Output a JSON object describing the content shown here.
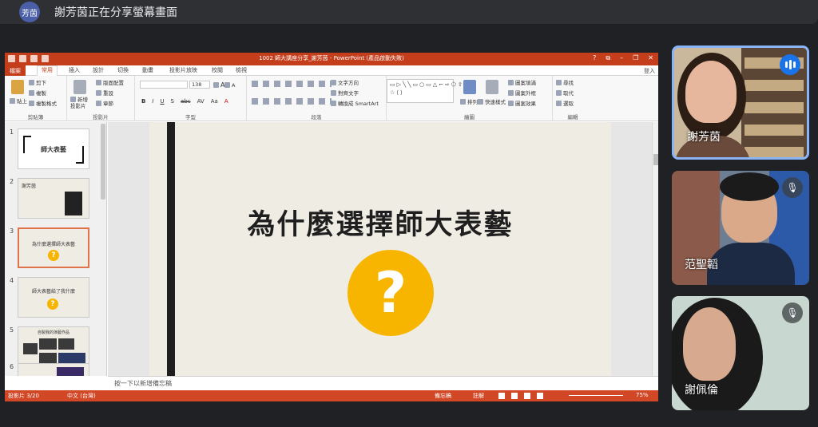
{
  "meeting": {
    "presenter_initials": "芳茵",
    "share_banner": "謝芳茵正在分享螢幕畫面"
  },
  "ppt": {
    "window_title": "1002 師大講座分享_謝芳茵 - PowerPoint (產品啟動失敗)",
    "window_controls": [
      "?",
      "⧉",
      "–",
      "❐",
      "✕"
    ],
    "tabs": [
      "檔案",
      "常用",
      "插入",
      "設計",
      "切換",
      "動畫",
      "投影片放映",
      "校閱",
      "檢視"
    ],
    "active_tab": "常用",
    "login": "登入",
    "ribbon": {
      "clipboard": {
        "label": "剪貼簿",
        "paste": "貼上",
        "cut": "剪下",
        "copy": "複製",
        "format_painter": "複製格式"
      },
      "slides": {
        "label": "投影片",
        "new_slide": "新增\n投影片",
        "layout": "版面配置",
        "reset": "重設",
        "section": "章節"
      },
      "font": {
        "label": "字型",
        "size": "138",
        "grow": "A",
        "shrink": "A",
        "styles": [
          "B",
          "I",
          "U",
          "S",
          "abc",
          "AV",
          "Aa",
          "A"
        ]
      },
      "paragraph": {
        "label": "段落",
        "text_direction": "文字方向",
        "align_text": "對齊文字",
        "smartart": "轉換成 SmartArt"
      },
      "drawing": {
        "label": "繪圖",
        "arrange": "排列",
        "quick_styles": "快速樣式",
        "fill": "圖案填滿",
        "outline": "圖案外框",
        "effects": "圖案效果",
        "shapes_preview": "▭▷╲╲▭○▭△⌐⇨⬠⇧{}☆⟨⟩"
      },
      "editing": {
        "label": "編輯",
        "find": "尋找",
        "replace": "取代",
        "select": "選取"
      }
    },
    "thumbnails": [
      {
        "num": "1",
        "text": "師大表藝"
      },
      {
        "num": "2",
        "text": "謝芳茵"
      },
      {
        "num": "3",
        "text": "為什麼選擇師大表藝"
      },
      {
        "num": "4",
        "text": "師大表藝給了我什麼"
      },
      {
        "num": "5",
        "text": "自製我的演藝作品"
      },
      {
        "num": "6",
        "text": ""
      }
    ],
    "slide": {
      "title": "為什麼選擇師大表藝",
      "question_mark": "?"
    },
    "notes_placeholder": "按一下以新增備忘稿",
    "status": {
      "slide_count": "投影片 3/20",
      "language": "中文 (台灣)",
      "notes": "備忘稿",
      "comments": "註解",
      "zoom": "75%"
    }
  },
  "participants": [
    {
      "name": "謝芳茵",
      "speaking": true
    },
    {
      "name": "范聖韜",
      "muted": true
    },
    {
      "name": "謝佩倫",
      "muted": true
    }
  ],
  "colors": {
    "ppt_accent": "#c43e1c",
    "speaking_border": "#8ab4f8",
    "question_yellow": "#f7b500"
  }
}
